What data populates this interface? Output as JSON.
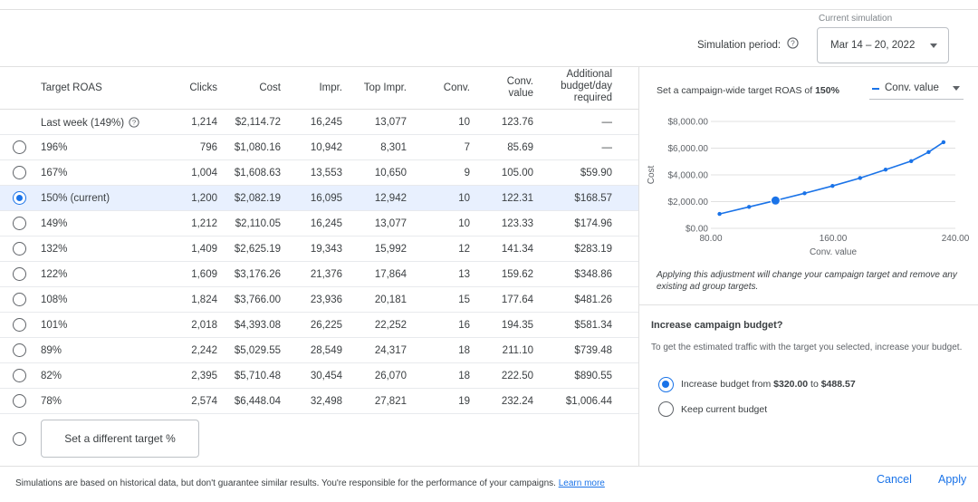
{
  "header": {
    "simulation_period_label": "Simulation period:",
    "dropdown_caption": "Current simulation",
    "dropdown_value": "Mar 14 – 20, 2022"
  },
  "table": {
    "columns": [
      "Target ROAS",
      "Clicks",
      "Cost",
      "Impr.",
      "Top Impr.",
      "Conv.",
      "Conv. value",
      "Additional budget/day required"
    ],
    "column_lines": {
      "conv_value": [
        "Conv.",
        "value"
      ],
      "additional": [
        "Additional",
        "budget/day",
        "required"
      ]
    },
    "last_week": {
      "label": "Last week (149%)",
      "cells": [
        "1,214",
        "$2,114.72",
        "16,245",
        "13,077",
        "10",
        "123.76",
        "—"
      ]
    },
    "rows": [
      {
        "label": "196%",
        "cells": [
          "796",
          "$1,080.16",
          "10,942",
          "8,301",
          "7",
          "85.69",
          "—"
        ],
        "selected": false
      },
      {
        "label": "167%",
        "cells": [
          "1,004",
          "$1,608.63",
          "13,553",
          "10,650",
          "9",
          "105.00",
          "$59.90"
        ],
        "selected": false
      },
      {
        "label": "150% (current)",
        "cells": [
          "1,200",
          "$2,082.19",
          "16,095",
          "12,942",
          "10",
          "122.31",
          "$168.57"
        ],
        "selected": true
      },
      {
        "label": "149%",
        "cells": [
          "1,212",
          "$2,110.05",
          "16,245",
          "13,077",
          "10",
          "123.33",
          "$174.96"
        ],
        "selected": false
      },
      {
        "label": "132%",
        "cells": [
          "1,409",
          "$2,625.19",
          "19,343",
          "15,992",
          "12",
          "141.34",
          "$283.19"
        ],
        "selected": false
      },
      {
        "label": "122%",
        "cells": [
          "1,609",
          "$3,176.26",
          "21,376",
          "17,864",
          "13",
          "159.62",
          "$348.86"
        ],
        "selected": false
      },
      {
        "label": "108%",
        "cells": [
          "1,824",
          "$3,766.00",
          "23,936",
          "20,181",
          "15",
          "177.64",
          "$481.26"
        ],
        "selected": false
      },
      {
        "label": "101%",
        "cells": [
          "2,018",
          "$4,393.08",
          "26,225",
          "22,252",
          "16",
          "194.35",
          "$581.34"
        ],
        "selected": false
      },
      {
        "label": "89%",
        "cells": [
          "2,242",
          "$5,029.55",
          "28,549",
          "24,317",
          "18",
          "211.10",
          "$739.48"
        ],
        "selected": false
      },
      {
        "label": "82%",
        "cells": [
          "2,395",
          "$5,710.48",
          "30,454",
          "26,070",
          "18",
          "222.50",
          "$890.55"
        ],
        "selected": false
      },
      {
        "label": "78%",
        "cells": [
          "2,574",
          "$6,448.04",
          "32,498",
          "27,821",
          "19",
          "232.24",
          "$1,006.44"
        ],
        "selected": false
      }
    ],
    "custom_target_button": "Set a different target %"
  },
  "chart": {
    "heading_prefix": "Set a campaign-wide target ROAS of ",
    "heading_value": "150%",
    "series_select": "Conv. value",
    "note": "Applying this adjustment will change your campaign target and remove any existing ad group targets."
  },
  "chart_data": {
    "type": "line",
    "title": "",
    "xlabel": "Conv. value",
    "ylabel": "Cost",
    "xlim": [
      80,
      240
    ],
    "ylim": [
      0,
      8000
    ],
    "x_ticks": [
      "80.00",
      "160.00",
      "240.00"
    ],
    "y_ticks": [
      "$0.00",
      "$2,000.00",
      "$4,000.00",
      "$6,000.00",
      "$8,000.00"
    ],
    "series": [
      {
        "x": [
          85.69,
          105.0,
          122.31,
          123.33,
          141.34,
          159.62,
          177.64,
          194.35,
          211.1,
          222.5,
          232.24
        ],
        "y": [
          1080.16,
          1608.63,
          2082.19,
          2110.05,
          2625.19,
          3176.26,
          3766.0,
          4393.08,
          5029.55,
          5710.48,
          6448.04
        ]
      }
    ],
    "highlight_x": 122.31,
    "highlight_y": 2082.19,
    "grid": true,
    "color": "#1a73e8"
  },
  "budget": {
    "title": "Increase campaign budget?",
    "description": "To get the estimated traffic with the target you selected, increase your budget.",
    "option_increase_prefix": "Increase budget from ",
    "option_increase_from": "$320.00",
    "option_increase_mid": " to ",
    "option_increase_to": "$488.57",
    "option_keep": "Keep current budget"
  },
  "footer": {
    "note": "Simulations are based on historical data, but don't guarantee similar results. You're responsible for the performance of your campaigns.",
    "learn_more": "Learn more",
    "cancel": "Cancel",
    "apply": "Apply"
  },
  "colors": {
    "accent": "#1a73e8",
    "selected_row": "#e8f0fe",
    "divider": "#e0e0e0"
  }
}
